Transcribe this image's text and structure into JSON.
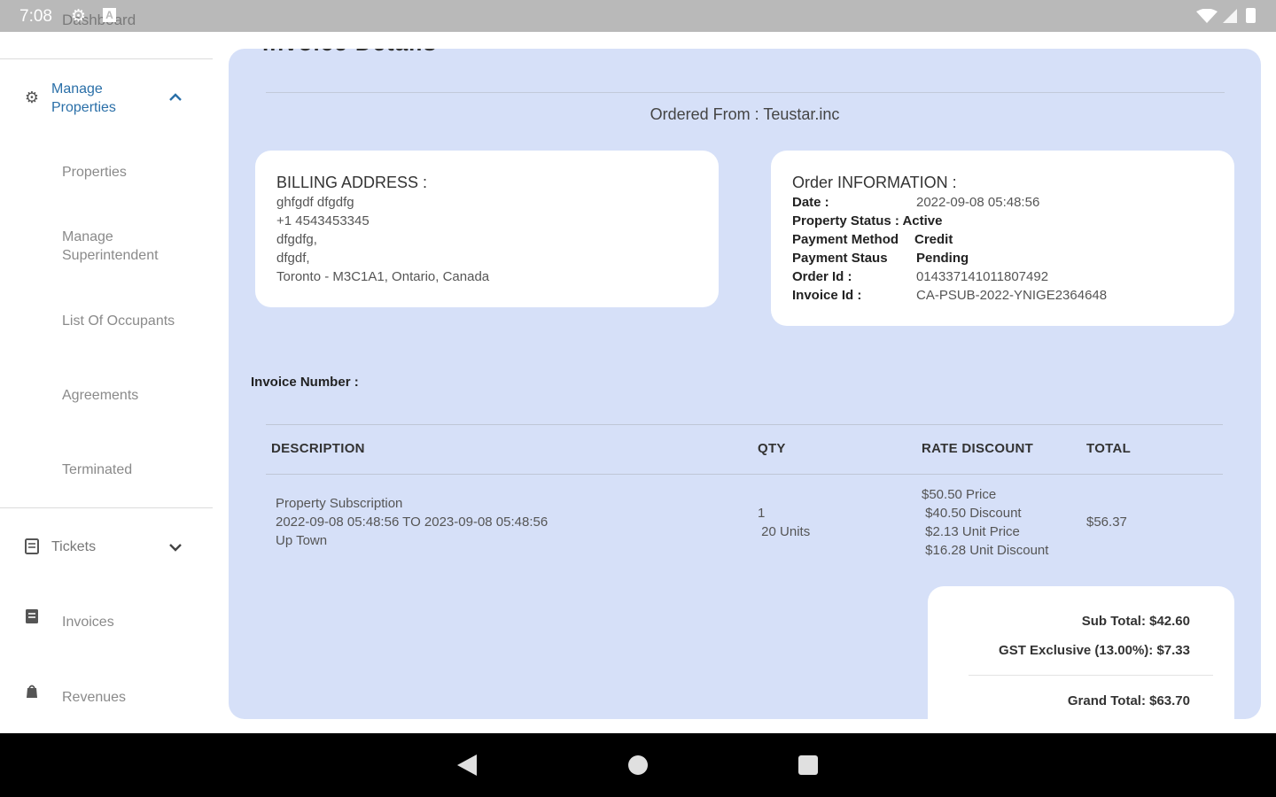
{
  "status_bar": {
    "time": "7:08",
    "under_label": "Dashboard",
    "a_badge": "A",
    "gear_icon": "gear-icon",
    "wifi_icon": "wifi-icon",
    "signal_icon": "signal-icon",
    "battery_icon": "battery-icon"
  },
  "sidebar": {
    "manage_properties": {
      "label": "Manage Properties",
      "icon": "gear-icon",
      "expanded": true,
      "accent_color": "#2a6fa8"
    },
    "sub_items": [
      "Properties",
      "Manage Superintendent",
      "List Of Occupants",
      "Agreements",
      "Terminated"
    ],
    "tickets": {
      "label": "Tickets",
      "icon": "ticket-icon"
    },
    "invoices": {
      "label": "Invoices",
      "icon": "invoice-icon"
    },
    "revenues": {
      "label": "Revenues",
      "icon": "revenue-icon"
    }
  },
  "invoice": {
    "title": "Invoice Details",
    "ordered_from": "Ordered From : Teustar.inc",
    "billing": {
      "heading": "BILLING ADDRESS :",
      "lines": [
        "ghfgdf dfgdfg",
        "+1 4543453345",
        "dfgdfg,",
        "dfgdf,",
        "Toronto - M3C1A1, Ontario, Canada"
      ]
    },
    "order_info": {
      "heading": "Order INFORMATION :",
      "date_label": "Date :",
      "date_value": "2022-09-08 05:48:56",
      "status_label": "Property Status : Active",
      "payment_method_label": "Payment Method",
      "payment_method_value": "Credit",
      "payment_status_label": "Payment Staus",
      "payment_status_value": "Pending",
      "order_id_label": "Order Id :",
      "order_id_value": "014337141011807492",
      "invoice_id_label": "Invoice Id :",
      "invoice_id_value": "CA-PSUB-2022-YNIGE2364648"
    },
    "invoice_number_label": "Invoice Number :",
    "table": {
      "headers": {
        "description": "DESCRIPTION",
        "qty": "QTY",
        "rate_discount": "RATE DISCOUNT",
        "total": "TOTAL"
      },
      "row": {
        "description": [
          "Property Subscription",
          "2022-09-08 05:48:56 TO 2023-09-08 05:48:56",
          "Up Town"
        ],
        "qty": [
          "1",
          " 20 Units"
        ],
        "rate_discount": [
          "$50.50 Price",
          " $40.50 Discount",
          " $2.13 Unit Price",
          " $16.28 Unit Discount"
        ],
        "total": "$56.37"
      }
    },
    "totals": {
      "sub_total": "Sub Total: $42.60",
      "gst": "GST Exclusive (13.00%): $7.33",
      "grand_total": "Grand Total: $63.70"
    },
    "card_color": "#d6e0f8"
  },
  "nav_bar": {
    "back_icon": "back-icon",
    "home_icon": "home-icon",
    "recents_icon": "recents-icon"
  }
}
